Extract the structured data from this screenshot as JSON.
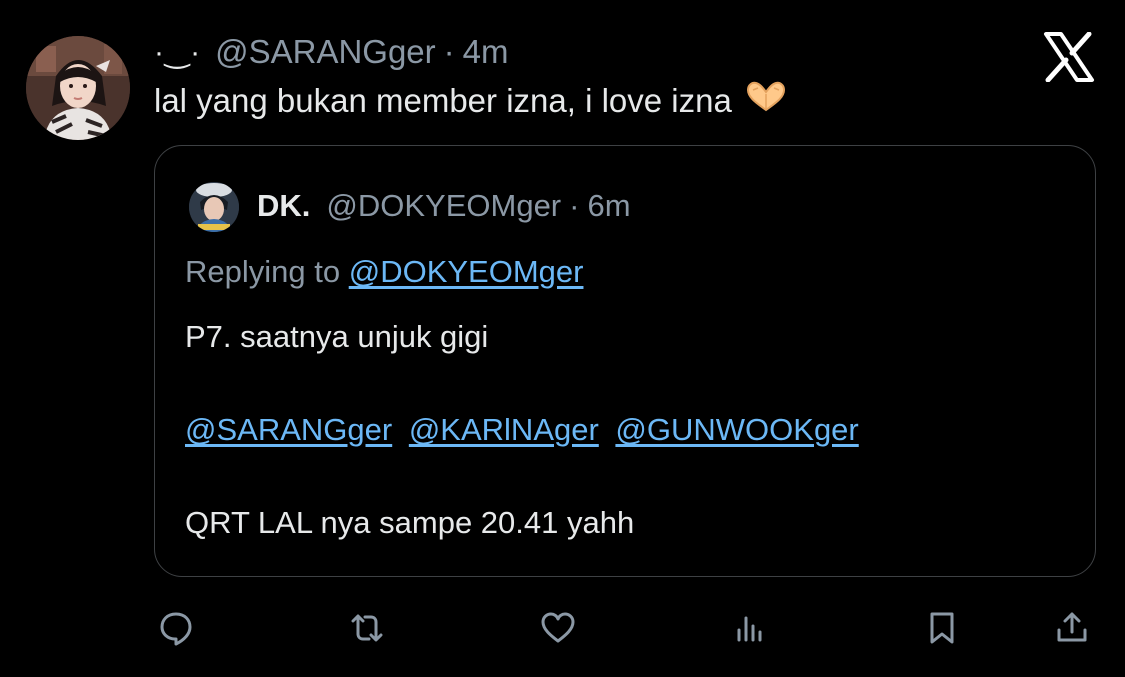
{
  "tweet": {
    "display_name": "·‿·",
    "handle": "@SARANGger",
    "separator": "·",
    "time": "4m",
    "text": "lal yang bukan member izna, i love izna",
    "emoji": "heart-hands-emoji"
  },
  "brand": {
    "logo": "x-logo-icon"
  },
  "quote": {
    "name": "DK.",
    "handle": "@DOKYEOMger",
    "separator": "·",
    "time": "6m",
    "replying_prefix": "Replying to",
    "replying_handle": "@DOKYEOMger",
    "line1": "P7. saatnya unjuk gigi",
    "mentions": [
      "@SARANGger",
      "@KARlNAger",
      "@GUNWOOKger"
    ],
    "line3": "QRT LAL nya sampe 20.41 yahh"
  },
  "actions": [
    {
      "name": "reply-icon"
    },
    {
      "name": "repost-icon"
    },
    {
      "name": "like-icon"
    },
    {
      "name": "views-icon"
    },
    {
      "name": "bookmark-icon"
    },
    {
      "name": "share-icon"
    }
  ],
  "colors": {
    "background": "#000000",
    "text": "#e7e9ea",
    "secondary": "#8b98a5",
    "link": "#6cb8f6",
    "border": "#3e4144"
  }
}
